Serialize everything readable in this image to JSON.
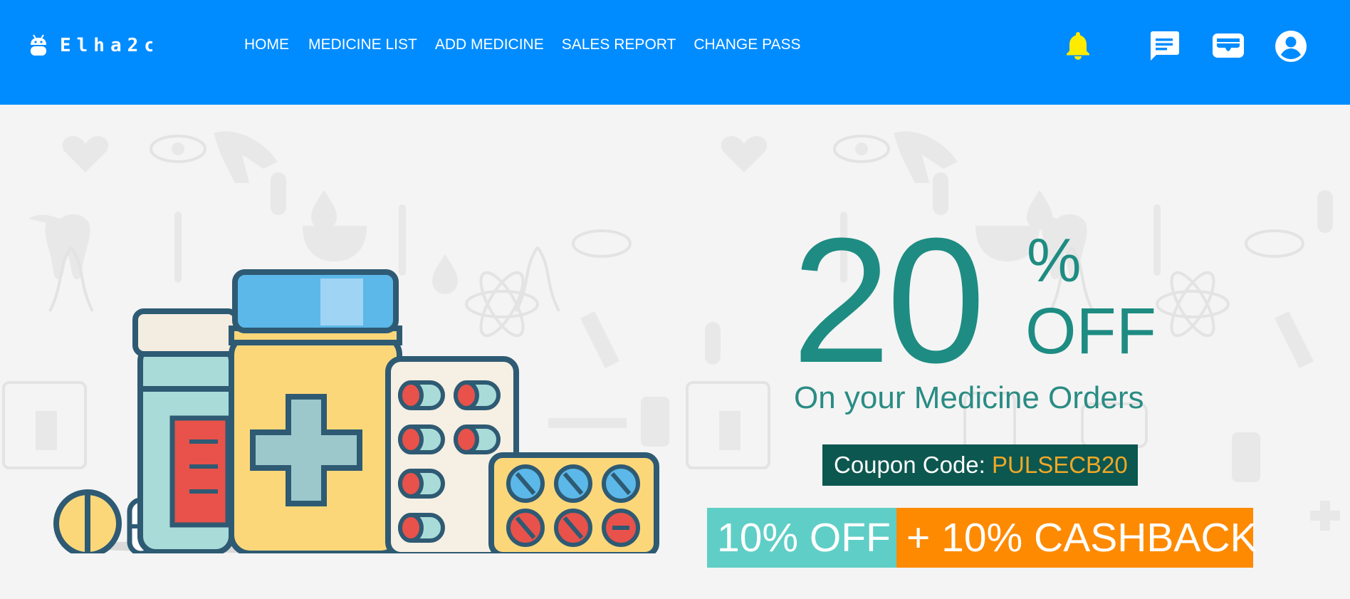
{
  "brand": {
    "name": "Elha2c",
    "icon": "android-icon"
  },
  "nav": {
    "links": [
      "HOME",
      "MEDICINE LIST",
      "ADD MEDICINE",
      "SALES REPORT",
      "CHANGE PASS"
    ],
    "icons": [
      "bell-icon",
      "chat-icon",
      "wallet-icon",
      "account-icon"
    ]
  },
  "banner": {
    "discount_number": "20",
    "discount_symbol": "%",
    "discount_word": "OFF",
    "subline": "On your Medicine Orders",
    "coupon_label": "Coupon Code: ",
    "coupon_code": "PULSECB20",
    "offer_left": "10% OFF",
    "offer_right": "+ 10% CASHBACK"
  },
  "colors": {
    "navbar": "#008cff",
    "bell": "#ffeb00",
    "teal_text": "#1e8c82",
    "coupon_bg": "#0c5750",
    "coupon_code": "#f0a826",
    "offer_left_bg": "#5fcec6",
    "offer_right_bg": "#fe8a02"
  }
}
